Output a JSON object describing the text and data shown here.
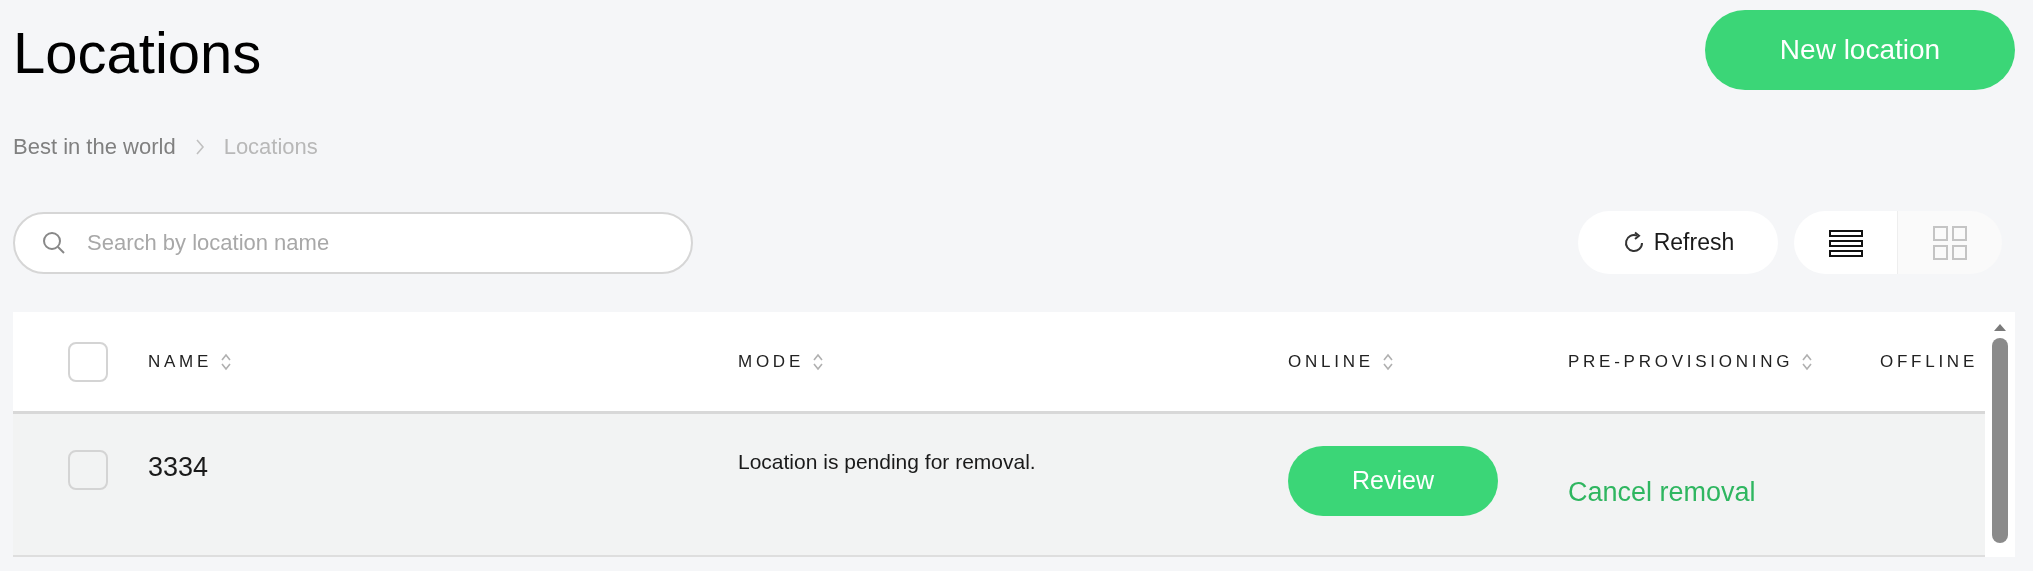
{
  "header": {
    "title": "Locations",
    "new_button": "New location"
  },
  "breadcrumb": [
    {
      "label": "Best in the world",
      "current": false
    },
    {
      "label": "Locations",
      "current": true
    }
  ],
  "search": {
    "placeholder": "Search by location name"
  },
  "toolbar": {
    "refresh": "Refresh",
    "views": [
      {
        "kind": "list",
        "selected": true
      },
      {
        "kind": "grid",
        "selected": false
      }
    ]
  },
  "table": {
    "select_all_checked": false,
    "columns": [
      {
        "label": "NAME",
        "sort_icon": true
      },
      {
        "label": "MODE",
        "sort_icon": true
      },
      {
        "label": "ONLINE",
        "sort_icon": true
      },
      {
        "label": "PRE-PROVISIONING",
        "sort_icon": true
      },
      {
        "label": "OFFLINE",
        "sort_icon": false
      }
    ],
    "rows": [
      {
        "checked": false,
        "name": "3334",
        "mode": "Location is pending for removal.",
        "online": {
          "kind": "button",
          "text": "Review"
        },
        "pre_provisioning": {
          "kind": "link",
          "text": "Cancel removal"
        }
      }
    ]
  }
}
